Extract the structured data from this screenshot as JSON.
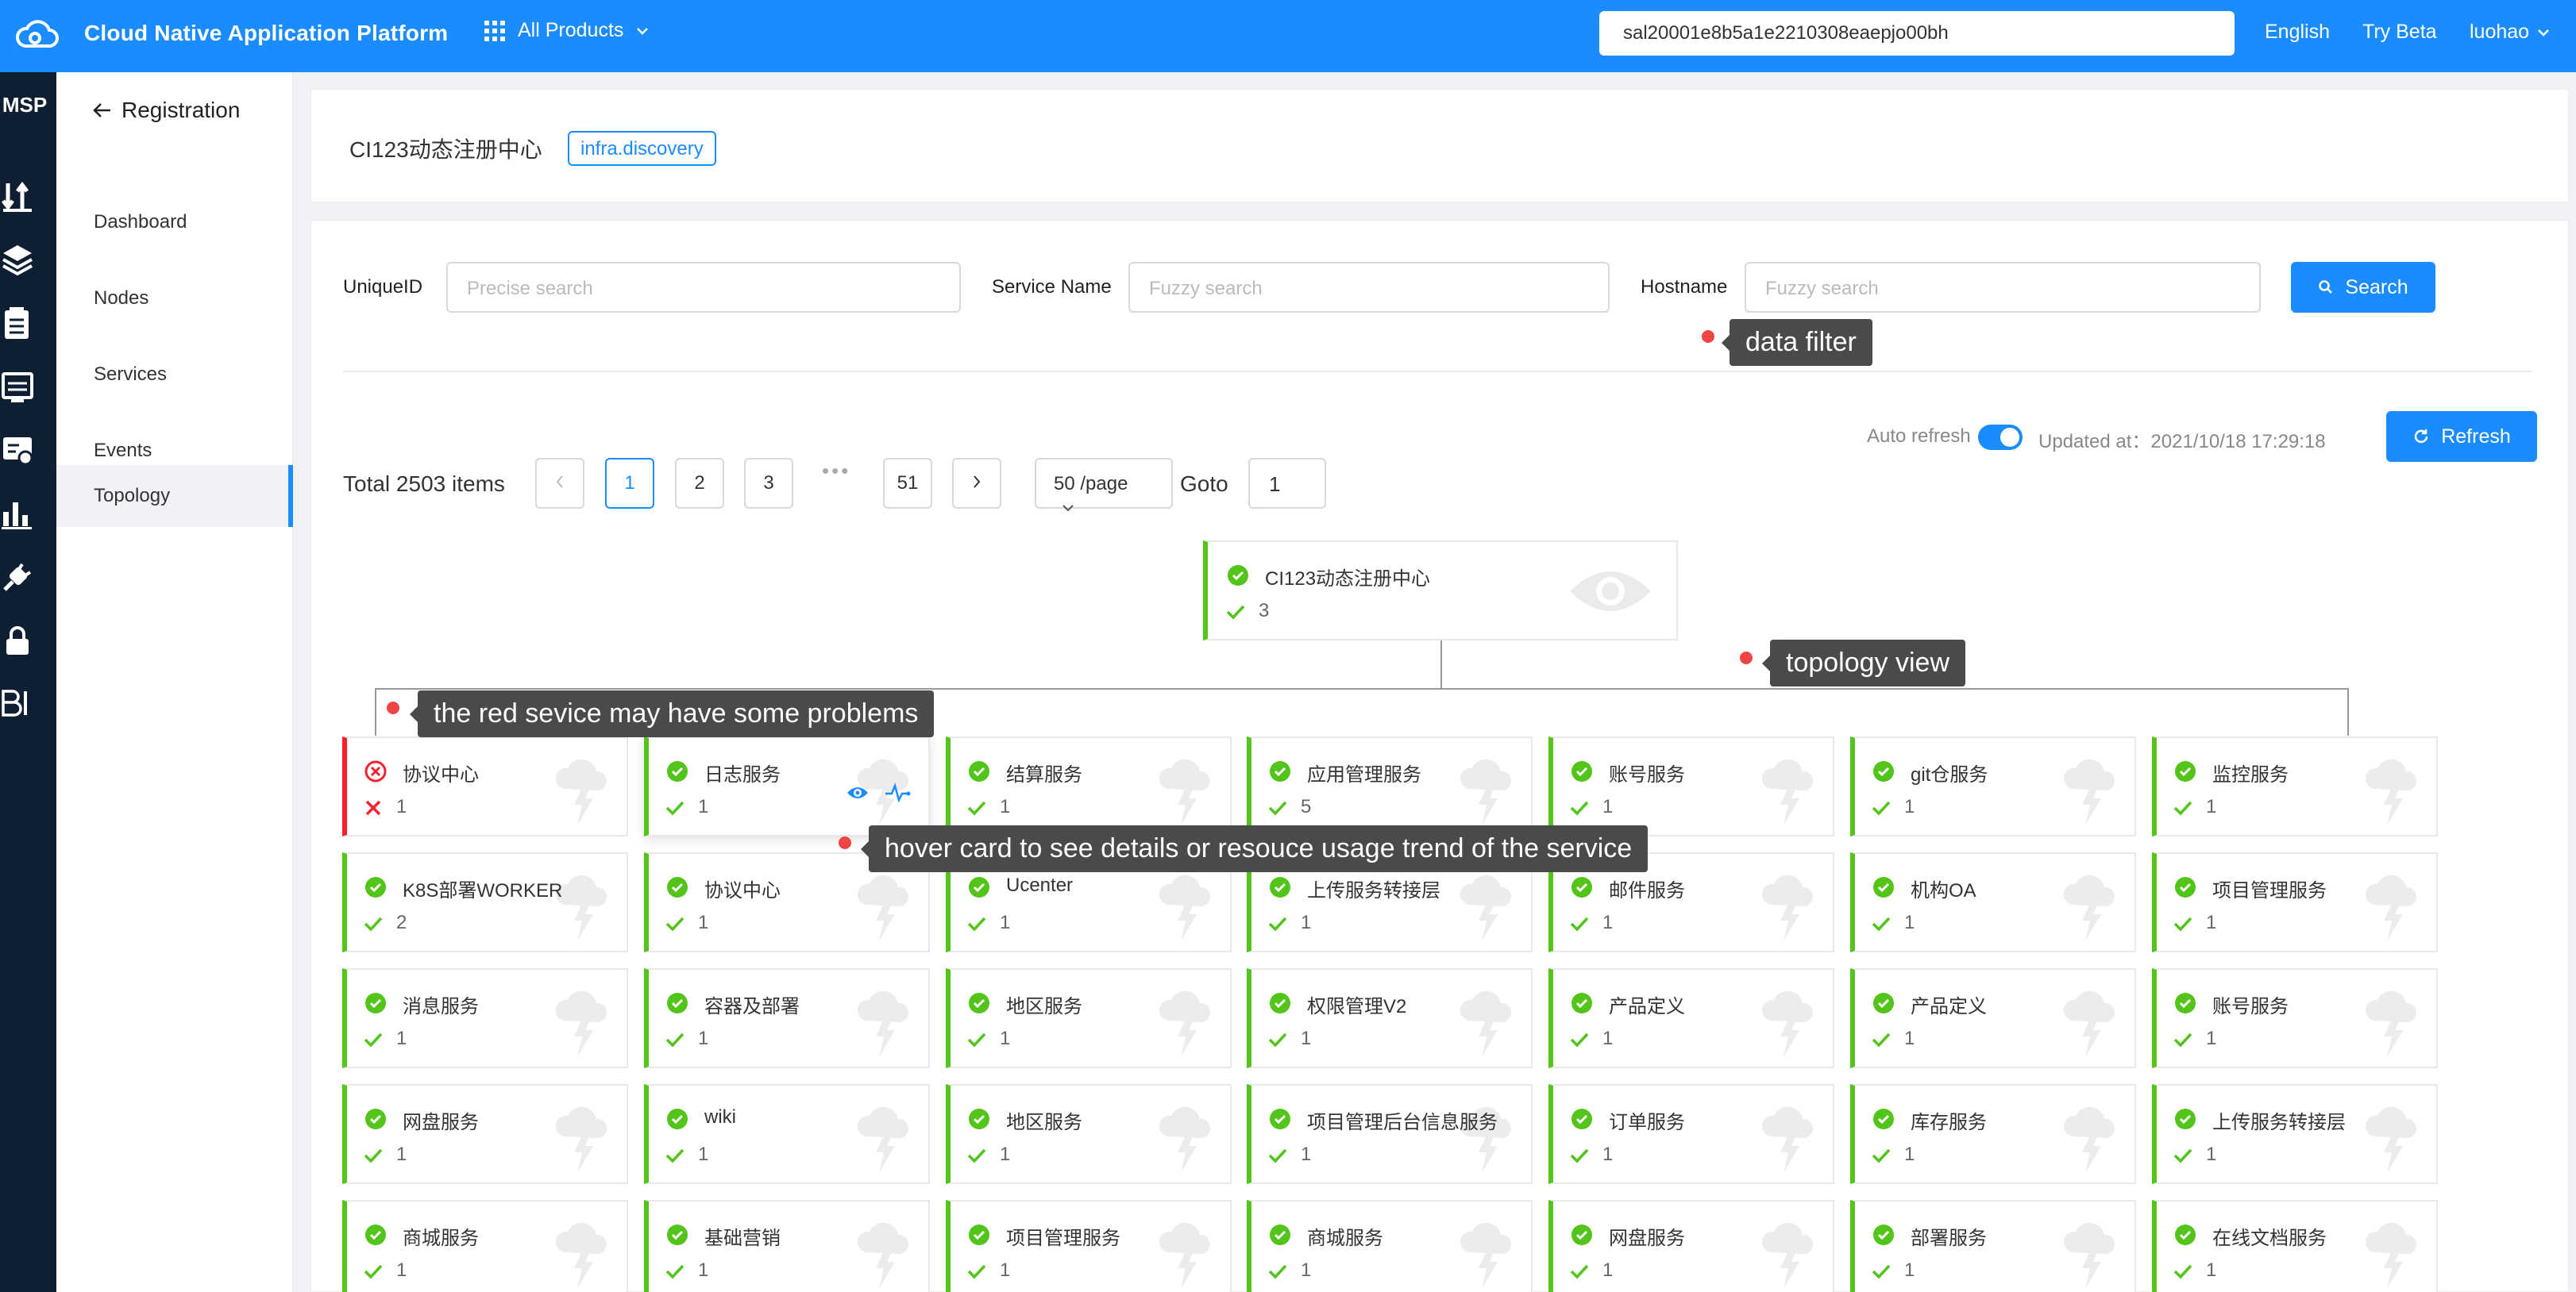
{
  "header": {
    "brand": "Cloud Native Application Platform",
    "products": "All Products",
    "search_value": "sal20001e8b5a1e2210308eaepjo00bh",
    "links": [
      "English",
      "Try Beta",
      "luohao"
    ]
  },
  "rail": {
    "title": "MSP",
    "icons": [
      "transfer-icon",
      "layers-icon",
      "document-icon",
      "monitor-icon",
      "screen-icon",
      "bar-chart-icon",
      "plug-icon",
      "lock-icon",
      "bi-icon"
    ]
  },
  "subnav": {
    "back_label": "Registration",
    "items": [
      "Dashboard",
      "Nodes",
      "Services",
      "Events",
      "Topology"
    ],
    "active": "Topology"
  },
  "registry": {
    "title": "CI123动态注册中心",
    "tag": "infra.discovery"
  },
  "filters": {
    "unique_id": {
      "label": "UniqueID",
      "placeholder": "Precise search"
    },
    "service_name": {
      "label": "Service Name",
      "placeholder": "Fuzzy search"
    },
    "hostname": {
      "label": "Hostname",
      "placeholder": "Fuzzy search"
    },
    "search_button": "Search"
  },
  "refresh": {
    "auto_label": "Auto refresh",
    "auto_on": true,
    "updated": "Updated at：2021/10/18 17:29:18",
    "button": "Refresh"
  },
  "pagination": {
    "total": "Total 2503 items",
    "pages": [
      "1",
      "2",
      "3",
      "51"
    ],
    "current": "1",
    "ellipsis": "•••",
    "page_size": "50 /page",
    "goto_label": "Goto",
    "goto_value": "1"
  },
  "topology": {
    "root": {
      "name": "CI123动态注册中心",
      "count": "3"
    },
    "services": [
      {
        "name": "协议中心",
        "count": "1",
        "status": "error"
      },
      {
        "name": "日志服务",
        "count": "1",
        "status": "ok"
      },
      {
        "name": "结算服务",
        "count": "1",
        "status": "ok"
      },
      {
        "name": "应用管理服务",
        "count": "5",
        "status": "ok"
      },
      {
        "name": "账号服务",
        "count": "1",
        "status": "ok"
      },
      {
        "name": "git仓服务",
        "count": "1",
        "status": "ok"
      },
      {
        "name": "监控服务",
        "count": "1",
        "status": "ok"
      },
      {
        "name": "K8S部署WORKER",
        "count": "2",
        "status": "ok"
      },
      {
        "name": "协议中心",
        "count": "1",
        "status": "ok"
      },
      {
        "name": "Ucenter",
        "count": "1",
        "status": "ok"
      },
      {
        "name": "上传服务转接层",
        "count": "1",
        "status": "ok"
      },
      {
        "name": "邮件服务",
        "count": "1",
        "status": "ok"
      },
      {
        "name": "机构OA",
        "count": "1",
        "status": "ok"
      },
      {
        "name": "项目管理服务",
        "count": "1",
        "status": "ok"
      },
      {
        "name": "消息服务",
        "count": "1",
        "status": "ok"
      },
      {
        "name": "容器及部署",
        "count": "1",
        "status": "ok"
      },
      {
        "name": "地区服务",
        "count": "1",
        "status": "ok"
      },
      {
        "name": "权限管理V2",
        "count": "1",
        "status": "ok"
      },
      {
        "name": "产品定义",
        "count": "1",
        "status": "ok"
      },
      {
        "name": "产品定义",
        "count": "1",
        "status": "ok"
      },
      {
        "name": "账号服务",
        "count": "1",
        "status": "ok"
      },
      {
        "name": "网盘服务",
        "count": "1",
        "status": "ok"
      },
      {
        "name": "wiki",
        "count": "1",
        "status": "ok"
      },
      {
        "name": "地区服务",
        "count": "1",
        "status": "ok"
      },
      {
        "name": "项目管理后台信息服务",
        "count": "1",
        "status": "ok"
      },
      {
        "name": "订单服务",
        "count": "1",
        "status": "ok"
      },
      {
        "name": "库存服务",
        "count": "1",
        "status": "ok"
      },
      {
        "name": "上传服务转接层",
        "count": "1",
        "status": "ok"
      },
      {
        "name": "商城服务",
        "count": "1",
        "status": "ok"
      },
      {
        "name": "基础营销",
        "count": "1",
        "status": "ok"
      },
      {
        "name": "项目管理服务",
        "count": "1",
        "status": "ok"
      },
      {
        "name": "商城服务",
        "count": "1",
        "status": "ok"
      },
      {
        "name": "网盘服务",
        "count": "1",
        "status": "ok"
      },
      {
        "name": "部署服务",
        "count": "1",
        "status": "ok"
      },
      {
        "name": "在线文档服务",
        "count": "1",
        "status": "ok"
      }
    ]
  },
  "annotations": {
    "data_filter": "data filter",
    "topology_view": "topology view",
    "red_service": "the red sevice may have some problems",
    "hover_card": "hover card to see details or resouce usage trend of the service"
  },
  "colors": {
    "primary": "#1a8cff",
    "ok": "#52c41a",
    "error": "#f5222d",
    "rail": "#0f1f33"
  }
}
